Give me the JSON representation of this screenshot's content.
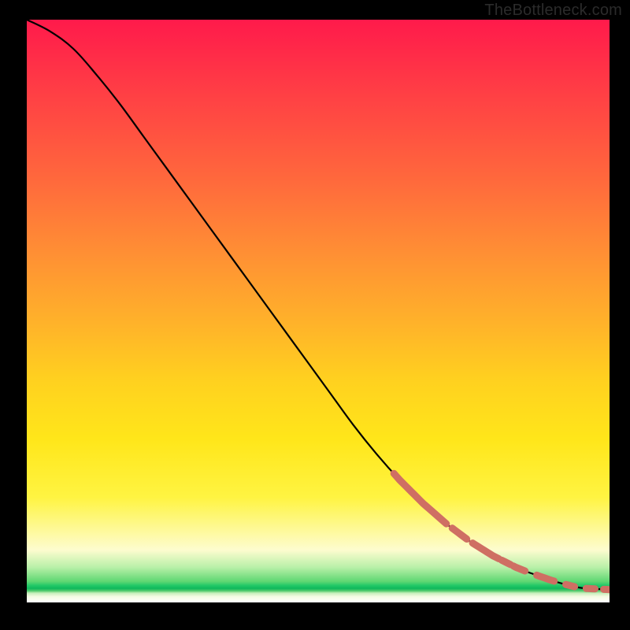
{
  "attribution": "TheBottleneck.com",
  "colors": {
    "curve": "#000000",
    "highlight": "#cf6f63",
    "gradient_top": "#ff1a4b",
    "gradient_mid": "#ffe61a",
    "gradient_green": "#22c867"
  },
  "chart_data": {
    "type": "line",
    "title": "",
    "xlabel": "",
    "ylabel": "",
    "xlim": [
      0,
      100
    ],
    "ylim": [
      0,
      100
    ],
    "series": [
      {
        "name": "bottleneck-curve",
        "x": [
          0,
          4,
          8,
          12,
          16,
          20,
          24,
          28,
          32,
          36,
          40,
          44,
          48,
          52,
          56,
          60,
          64,
          68,
          72,
          76,
          80,
          84,
          86,
          88,
          90,
          92,
          94,
          96,
          98,
          100
        ],
        "y": [
          100,
          98,
          95,
          90.5,
          85.5,
          80,
          74.5,
          69,
          63.5,
          58,
          52.5,
          47,
          41.5,
          36,
          30.5,
          25.5,
          21,
          17,
          13.5,
          10.5,
          8.0,
          6.0,
          5.2,
          4.5,
          3.8,
          3.2,
          2.7,
          2.4,
          2.3,
          2.2
        ]
      }
    ],
    "highlight_segments": [
      {
        "x0": 63,
        "x1": 72
      },
      {
        "x0": 73,
        "x1": 75.5
      },
      {
        "x0": 76.5,
        "x1": 81
      },
      {
        "x0": 81.5,
        "x1": 83
      },
      {
        "x0": 83.5,
        "x1": 85.5
      },
      {
        "x0": 87.5,
        "x1": 90.5
      },
      {
        "x0": 92.5,
        "x1": 94
      },
      {
        "x0": 96,
        "x1": 97.5
      },
      {
        "x0": 99,
        "x1": 100
      }
    ],
    "highlight_stroke_width": 9
  }
}
